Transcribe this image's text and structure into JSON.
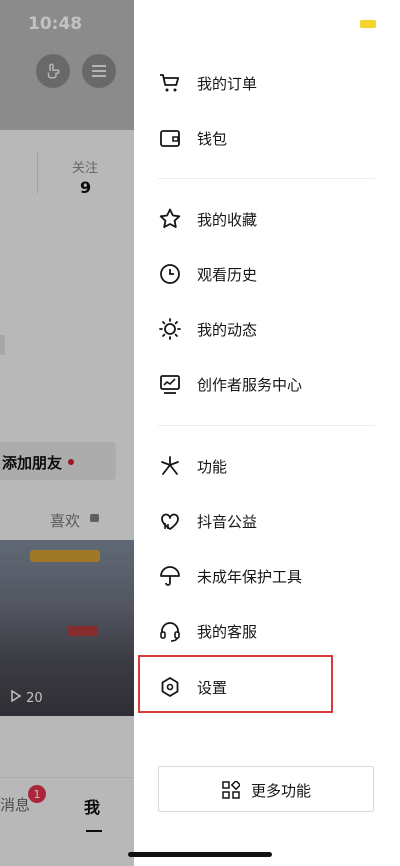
{
  "status_bar": {
    "time": "10:48"
  },
  "left_panel": {
    "follow": {
      "label": "关注",
      "value": "9"
    },
    "add_friend_label": "添加朋友",
    "likes_tab_label": "喜欢",
    "video": {
      "play_count": "20"
    },
    "bottom_nav": {
      "messages_label": "消息",
      "messages_badge": "1",
      "me_label": "我"
    }
  },
  "drawer": {
    "group1": [
      {
        "label": "我的订单",
        "icon": "cart-icon"
      },
      {
        "label": "钱包",
        "icon": "wallet-icon"
      }
    ],
    "group2": [
      {
        "label": "我的收藏",
        "icon": "star-icon"
      },
      {
        "label": "观看历史",
        "icon": "clock-icon"
      },
      {
        "label": "我的动态",
        "icon": "sun-icon"
      },
      {
        "label": "创作者服务中心",
        "icon": "chart-icon"
      }
    ],
    "group3": [
      {
        "label": "功能",
        "icon": "function-icon"
      },
      {
        "label": "抖音公益",
        "icon": "heart-hand-icon"
      },
      {
        "label": "未成年保护工具",
        "icon": "umbrella-icon"
      },
      {
        "label": "我的客服",
        "icon": "headset-icon"
      },
      {
        "label": "设置",
        "icon": "settings-hex-icon"
      }
    ],
    "more_button_label": "更多功能"
  },
  "colors": {
    "accent_red": "#d93b3b",
    "badge_red": "#e0334e",
    "battery_yellow": "#f6d22a"
  }
}
